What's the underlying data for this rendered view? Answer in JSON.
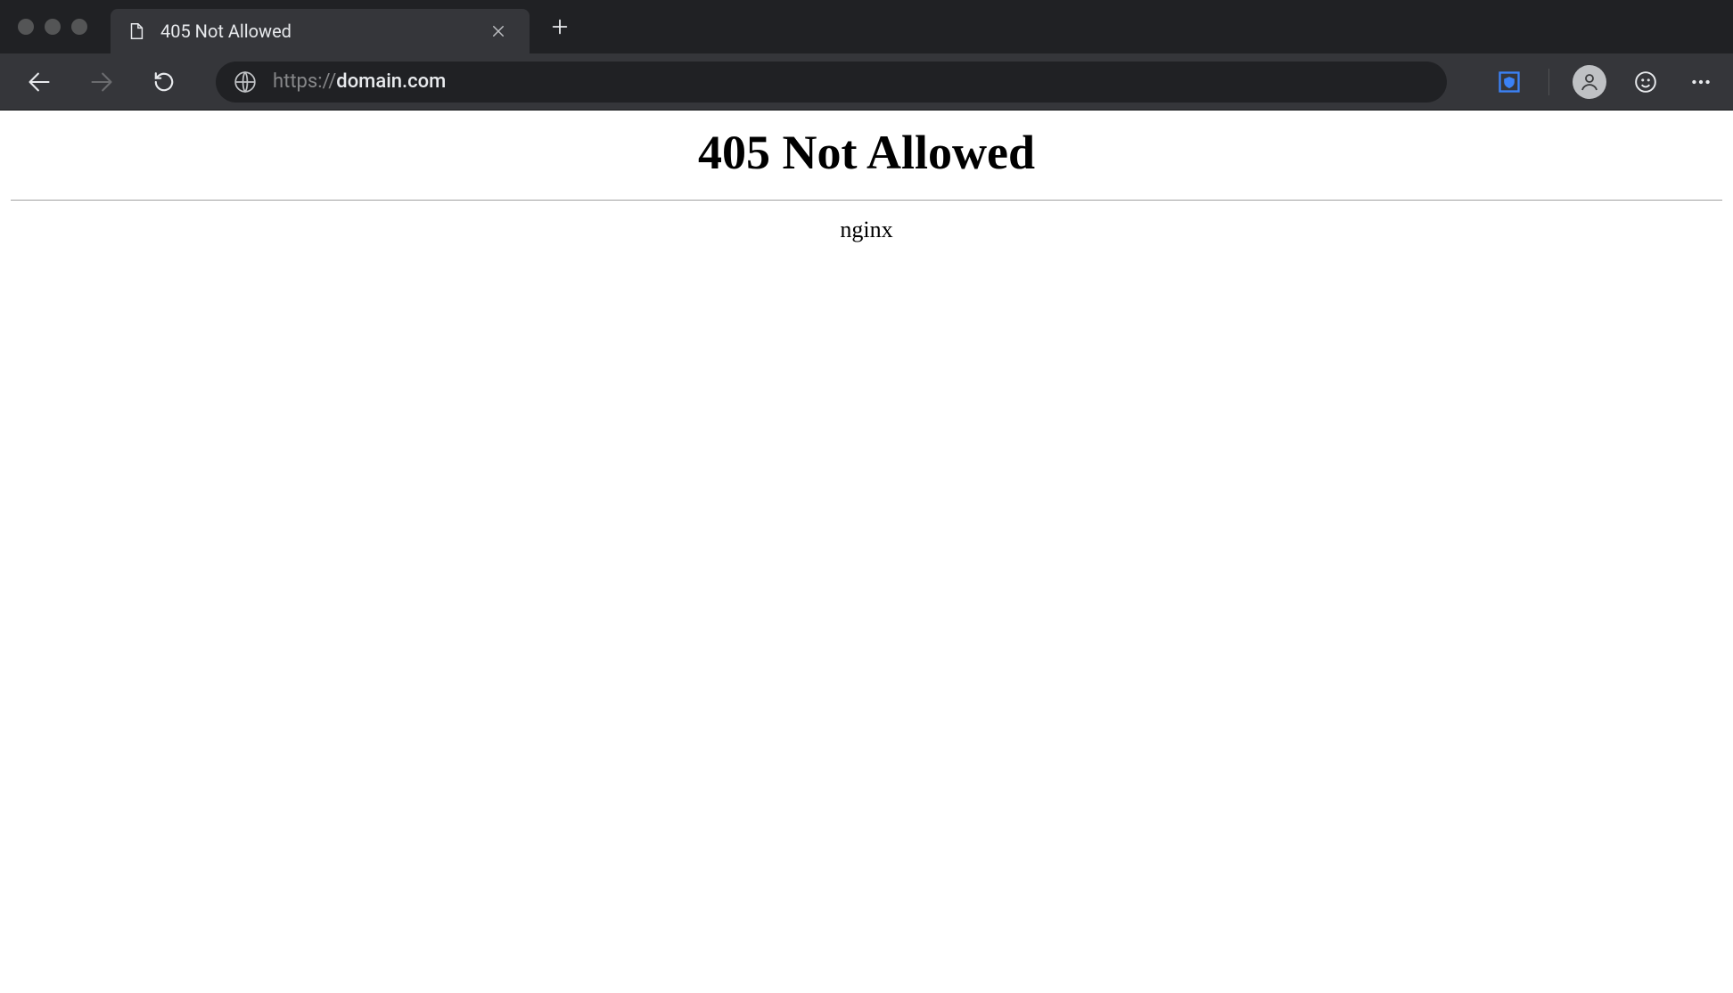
{
  "tab": {
    "title": "405 Not Allowed"
  },
  "address": {
    "scheme": "https://",
    "host": "domain.com"
  },
  "page": {
    "heading": "405 Not Allowed",
    "server": "nginx"
  }
}
